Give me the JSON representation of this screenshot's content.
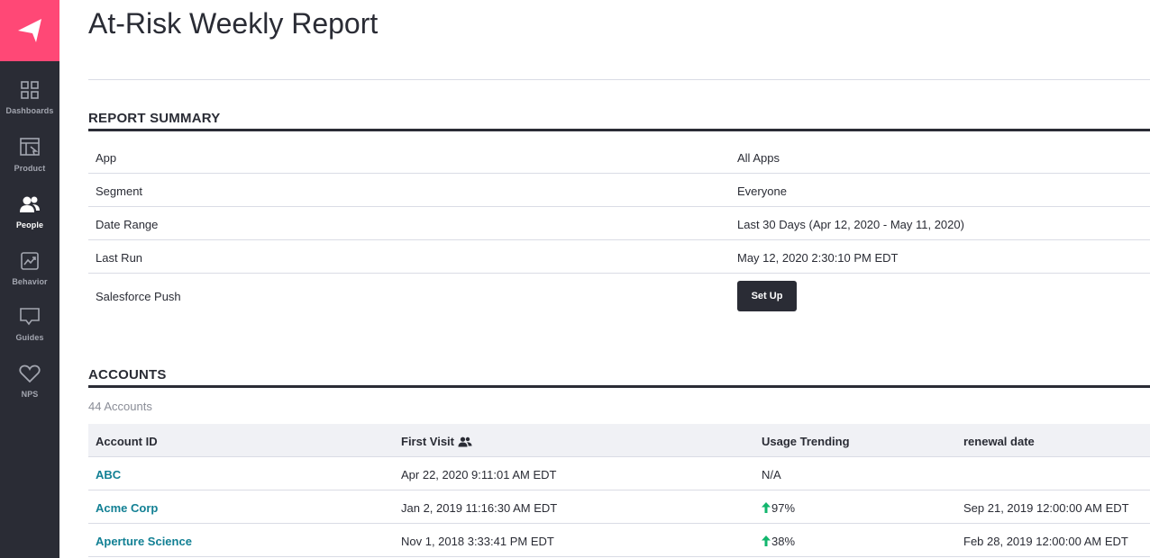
{
  "sidebar": {
    "items": [
      {
        "label": "Dashboards",
        "icon": "grid-icon"
      },
      {
        "label": "Product",
        "icon": "product-icon"
      },
      {
        "label": "People",
        "icon": "people-icon",
        "active": true
      },
      {
        "label": "Behavior",
        "icon": "chart-icon"
      },
      {
        "label": "Guides",
        "icon": "chat-icon"
      },
      {
        "label": "NPS",
        "icon": "heart-icon"
      }
    ]
  },
  "page": {
    "title": "At-Risk Weekly Report"
  },
  "summary": {
    "heading": "REPORT SUMMARY",
    "rows": [
      {
        "key": "App",
        "value": "All Apps"
      },
      {
        "key": "Segment",
        "value": "Everyone"
      },
      {
        "key": "Date Range",
        "value": "Last 30 Days (Apr 12, 2020 - May 11, 2020)"
      },
      {
        "key": "Last Run",
        "value": "May 12, 2020 2:30:10 PM EDT"
      }
    ],
    "salesforce_label": "Salesforce Push",
    "setup_button": "Set Up"
  },
  "accounts": {
    "heading": "ACCOUNTS",
    "count": "44 Accounts",
    "columns": [
      "Account ID",
      "First Visit",
      "Usage Trending",
      "renewal date"
    ],
    "rows": [
      {
        "id": "ABC",
        "first_visit": "Apr 22, 2020 9:11:01 AM EDT",
        "trend": "N/A",
        "trend_up": false,
        "renewal": ""
      },
      {
        "id": "Acme Corp",
        "first_visit": "Jan 2, 2019 11:16:30 AM EDT",
        "trend": "97%",
        "trend_up": true,
        "renewal": "Sep 21, 2019 12:00:00 AM EDT"
      },
      {
        "id": "Aperture Science",
        "first_visit": "Nov 1, 2018 3:33:41 PM EDT",
        "trend": "38%",
        "trend_up": true,
        "renewal": "Feb 28, 2019 12:00:00 AM EDT"
      }
    ]
  },
  "colors": {
    "brand": "#ff4876",
    "sidebar": "#2a2c35",
    "link": "#128094",
    "trend_up": "#12b66d"
  }
}
